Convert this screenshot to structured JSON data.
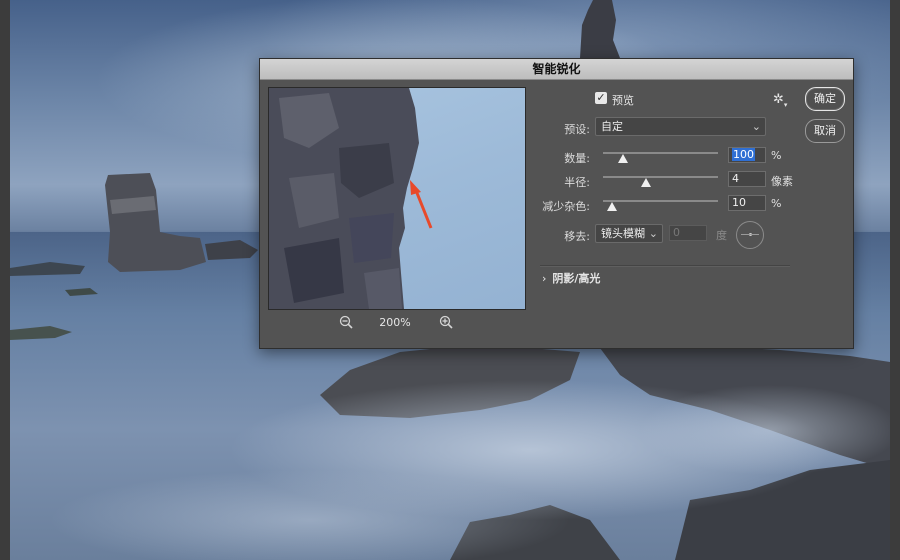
{
  "dialog": {
    "title": "智能锐化",
    "preview_checkbox": "预览",
    "preview_checked": "✓",
    "zoom": "200%",
    "buttons": {
      "ok": "确定",
      "cancel": "取消"
    },
    "preset": {
      "label": "预设:",
      "value": "自定"
    },
    "amount": {
      "label": "数量:",
      "value": "100",
      "unit": "%",
      "slider_fraction": 0.18
    },
    "radius": {
      "label": "半径:",
      "value": "4",
      "unit": "像素",
      "slider_fraction": 0.37
    },
    "reduce_noise": {
      "label": "减少杂色:",
      "value": "10",
      "unit": "%",
      "slider_fraction": 0.07
    },
    "remove": {
      "label": "移去:",
      "value": "镜头模糊",
      "angle": "0",
      "angle_unit": "度"
    },
    "shadows_highlights": "阴影/高光"
  },
  "colors": {
    "dialog_bg": "#535353",
    "arrow": "#e8492a",
    "selection": "#2f6fd3"
  },
  "icons": [
    "checkbox-icon",
    "gear-icon",
    "zoom-out-icon",
    "zoom-in-icon",
    "chevron-down-icon",
    "chevron-right-icon",
    "angle-dial-icon"
  ]
}
